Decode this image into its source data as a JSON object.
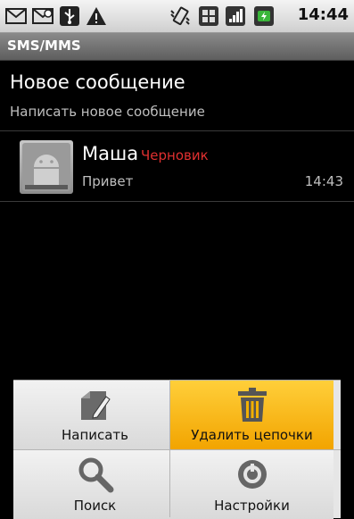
{
  "status_bar": {
    "time": "14:44",
    "icons": [
      "gmail-icon",
      "mms-notification-icon",
      "usb-icon",
      "warning-icon",
      "vibrate-icon",
      "data-transfer-icon",
      "signal-icon",
      "battery-charging-icon"
    ]
  },
  "app_title": "SMS/MMS",
  "new_message": {
    "title": "Новое сообщение",
    "subtitle": "Написать новое сообщение"
  },
  "conversations": [
    {
      "name": "Маша",
      "draft_label": "Черновик",
      "preview": "Привет",
      "time": "14:43"
    }
  ],
  "menu": {
    "items": [
      {
        "label": "Написать",
        "icon": "compose-icon"
      },
      {
        "label": "Удалить цепочки",
        "icon": "trash-icon",
        "selected": true
      },
      {
        "label": "Поиск",
        "icon": "search-icon"
      },
      {
        "label": "Настройки",
        "icon": "settings-icon"
      }
    ]
  },
  "colors": {
    "menu_highlight": "#f2a400",
    "draft": "#e03030",
    "background": "#000000"
  }
}
